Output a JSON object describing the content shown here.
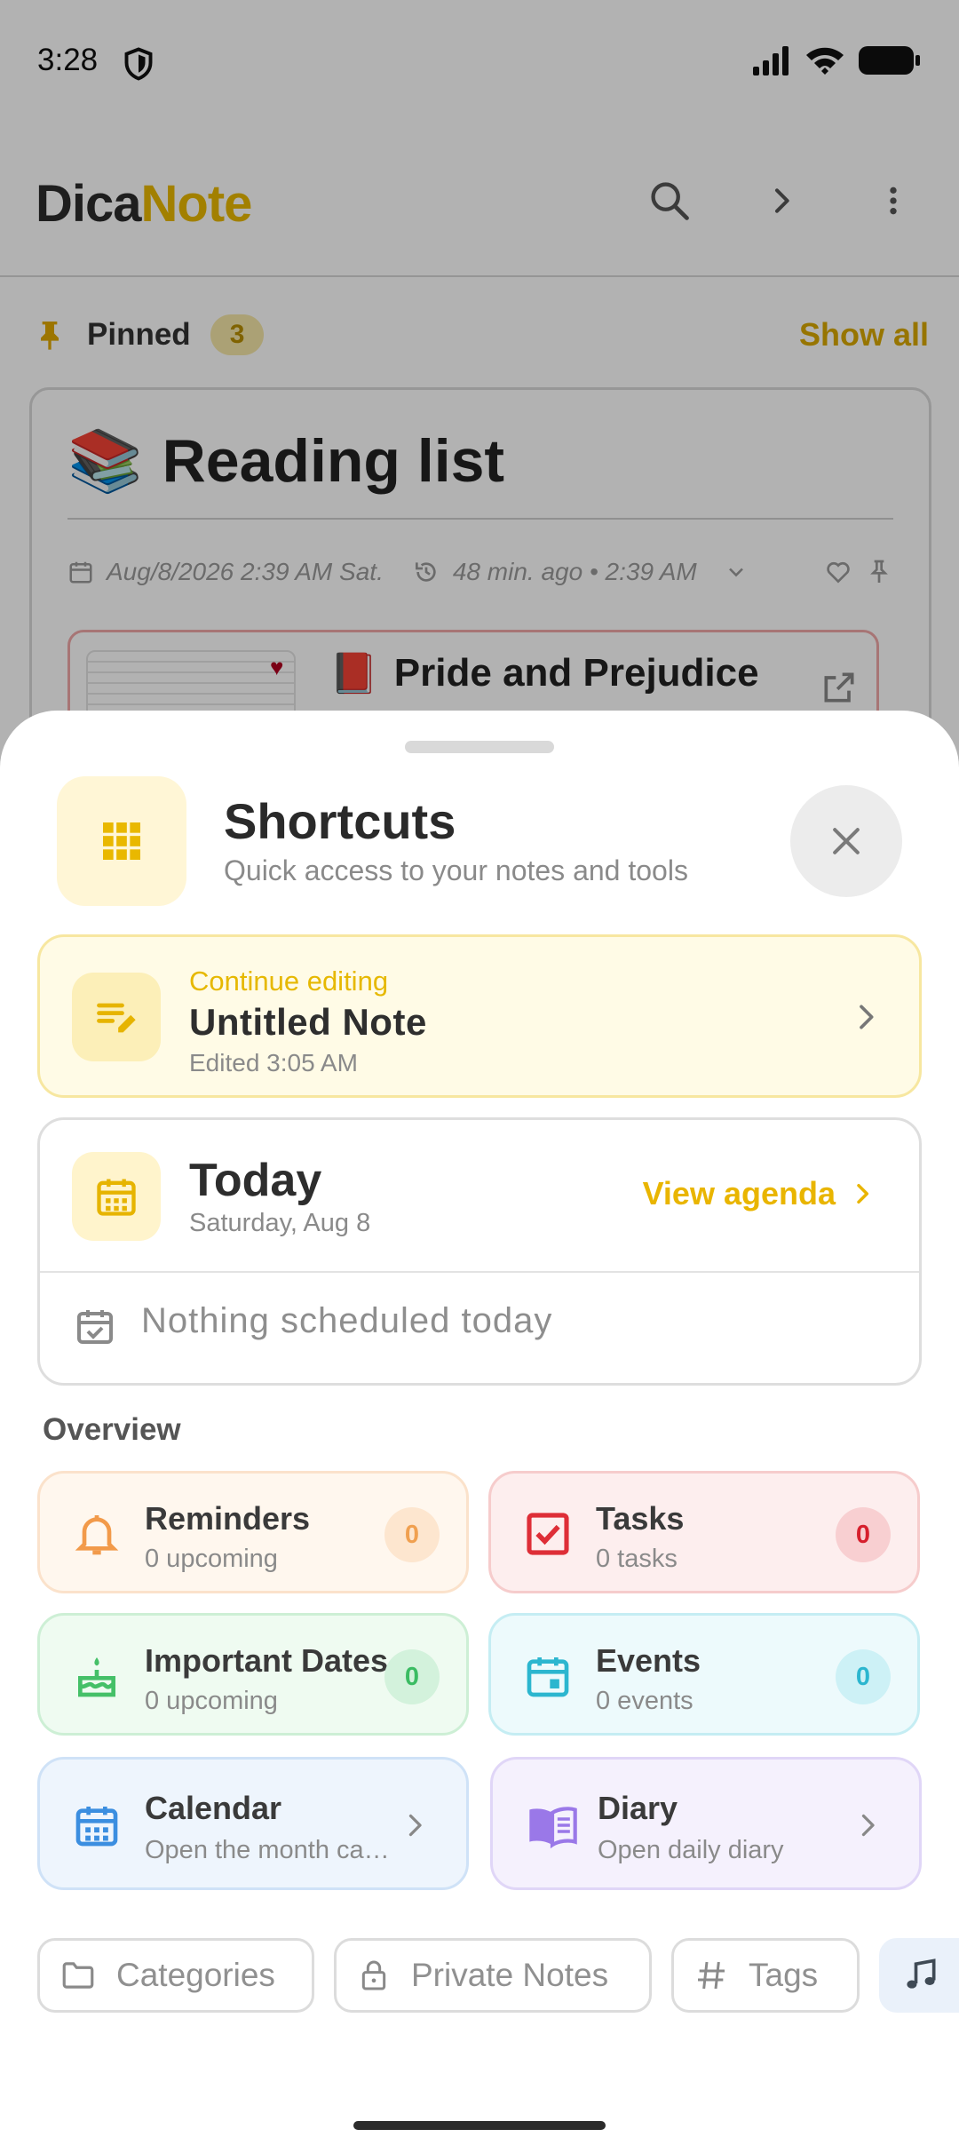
{
  "status_bar": {
    "time": "3:28"
  },
  "app": {
    "logo_part1": "Dica",
    "logo_part2": "Note",
    "pinned": {
      "label": "Pinned",
      "count": "3",
      "show_all": "Show all"
    },
    "note": {
      "emoji": "📚",
      "title": "Reading list",
      "created": "Aug/8/2026 2:39 AM Sat.",
      "edited": "48 min. ago • 2:39 AM",
      "sub_emoji": "📕",
      "sub_title": "Pride and Prejudice"
    }
  },
  "sheet": {
    "title": "Shortcuts",
    "subtitle": "Quick access to your notes and tools",
    "continue": {
      "kicker": "Continue editing",
      "title": "Untitled Note",
      "time": "Edited 3:05 AM"
    },
    "today": {
      "title": "Today",
      "date": "Saturday, Aug 8",
      "agenda": "View agenda",
      "empty": "Nothing scheduled today"
    },
    "overview_title": "Overview",
    "tiles": [
      {
        "title": "Reminders",
        "sub": "0 upcoming",
        "badge": "0"
      },
      {
        "title": "Tasks",
        "sub": "0 tasks",
        "badge": "0"
      },
      {
        "title": "Important Dates",
        "sub": "0 upcoming",
        "badge": "0"
      },
      {
        "title": "Events",
        "sub": "0 events",
        "badge": "0"
      },
      {
        "title": "Calendar",
        "sub": "Open the month calendar"
      },
      {
        "title": "Diary",
        "sub": "Open daily diary"
      }
    ],
    "chips": [
      "Categories",
      "Private Notes",
      "Tags"
    ]
  },
  "colors": {
    "accent": "#e8b800",
    "reminders": "#f5a05a",
    "tasks": "#e0323c",
    "important_dates": "#4cc46b",
    "events": "#2eb8d0",
    "calendar": "#3d8fe0",
    "diary": "#9b7be8"
  }
}
